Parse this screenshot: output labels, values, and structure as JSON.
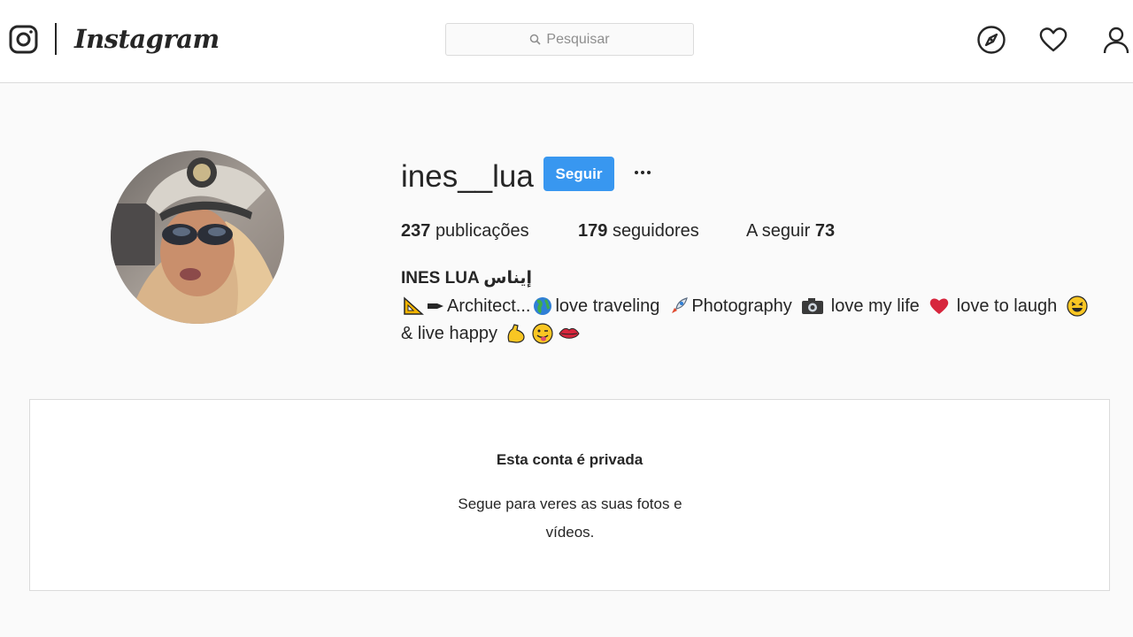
{
  "nav": {
    "brand": "Instagram",
    "search_placeholder": "Pesquisar"
  },
  "profile": {
    "username": "ines__lua",
    "follow_label": "Seguir",
    "stats": {
      "posts_count": "237",
      "posts_label": "publicações",
      "followers_count": "179",
      "followers_label": "seguidores",
      "following_label": "A seguir",
      "following_count": "73"
    },
    "full_name": "INES LUA إيناس",
    "bio": {
      "architect": "Architect...",
      "traveling": "love traveling",
      "photography": "Photography",
      "life": "love my life",
      "laugh": "love to laugh",
      "happy": "& live happy"
    }
  },
  "private": {
    "title": "Esta conta é privada",
    "subtitle": "Segue para veres as suas fotos e vídeos."
  },
  "colors": {
    "follow_blue": "#3897f0",
    "border": "#dbdbdb",
    "background": "#fafafa"
  }
}
